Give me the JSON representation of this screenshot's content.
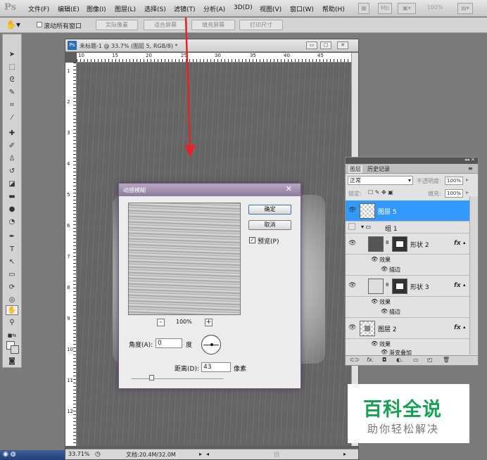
{
  "app": {
    "logo": "Ps"
  },
  "menu": [
    "文件(F)",
    "编辑(E)",
    "图像(I)",
    "图层(L)",
    "选择(S)",
    "滤镜(T)",
    "分析(A)",
    "3D(D)",
    "视图(V)",
    "窗口(W)",
    "帮助(H)"
  ],
  "menubar_right": {
    "zoom": "100%",
    "mb": "Mb"
  },
  "options": {
    "scroll_all": "滚动所有窗口",
    "buttons": [
      "实际像素",
      "适合屏幕",
      "填充屏幕",
      "打印尺寸"
    ]
  },
  "document": {
    "title": "未标题-1 @ 33.7% (图层 5, RGB/8) *",
    "ruler_h": [
      "10",
      "15",
      "20",
      "25",
      "30",
      "35",
      "40",
      "45"
    ],
    "ruler_v": [
      "1",
      "2",
      "3",
      "4",
      "5",
      "6",
      "7",
      "8",
      "9",
      "10",
      "11",
      "12"
    ],
    "status_zoom": "33.71%",
    "status_doc": "文档:20.4M/32.0M"
  },
  "dialog": {
    "title": "动感模糊",
    "ok": "确定",
    "cancel": "取消",
    "preview_label": "预览(P)",
    "zoom": "100%",
    "angle_label": "角度(A):",
    "angle_value": "0",
    "angle_unit": "度",
    "distance_label": "距离(D):",
    "distance_value": "43",
    "distance_unit": "像素",
    "slider_position": 0.22
  },
  "layers_panel": {
    "tabs": [
      "图层",
      "历史记录"
    ],
    "blend_mode": "正常",
    "opacity_label": "不透明度:",
    "opacity_value": "100%",
    "lock_label": "锁定:",
    "fill_label": "填充:",
    "fill_value": "100%",
    "layers": [
      {
        "name": "图层 5",
        "selected": true
      },
      {
        "name": "组 1"
      },
      {
        "name": "形状 2",
        "fx": "fx"
      },
      {
        "name": "效果"
      },
      {
        "name": "描边"
      },
      {
        "name": "形状 3",
        "fx": "fx"
      },
      {
        "name": "效果"
      },
      {
        "name": "描边"
      },
      {
        "name": "图层 2",
        "fx": "fx"
      },
      {
        "name": "效果"
      },
      {
        "name": "渐变叠加"
      }
    ]
  },
  "watermark": {
    "line1": "百科全说",
    "line2": "助你轻松解决"
  },
  "colors": {
    "accent": "#3399ff",
    "dialog_title": "#8d7b9c",
    "arrow": "#e0262b",
    "watermark_green": "#18a053"
  }
}
